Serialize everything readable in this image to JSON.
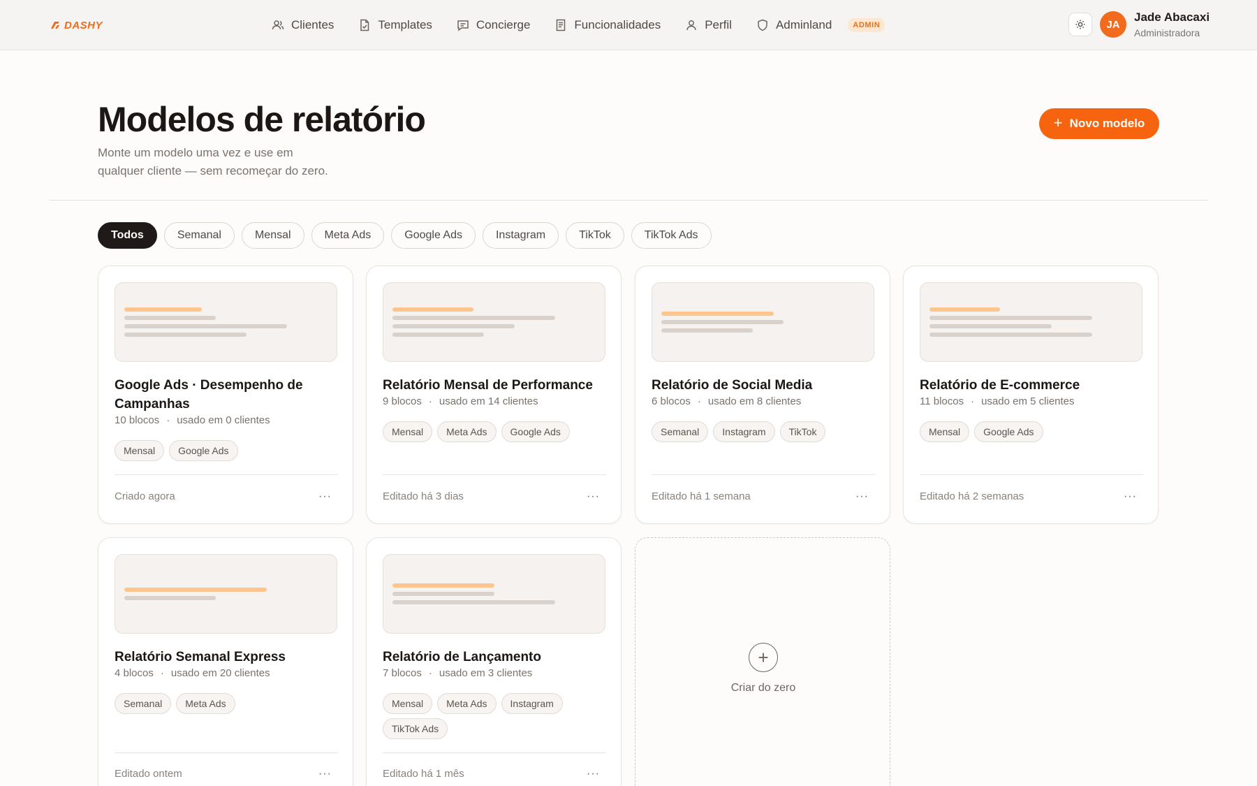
{
  "brand": {
    "name": "DASHY",
    "accent": "#f7640f"
  },
  "nav": [
    {
      "label": "Clientes",
      "icon": "users-icon"
    },
    {
      "label": "Templates",
      "icon": "file-check-icon"
    },
    {
      "label": "Concierge",
      "icon": "chat-icon"
    },
    {
      "label": "Funcionalidades",
      "icon": "document-icon"
    },
    {
      "label": "Perfil",
      "icon": "user-icon"
    },
    {
      "label": "Adminland",
      "icon": "shield-icon",
      "badge": "ADMIN"
    }
  ],
  "user": {
    "initials": "JA",
    "name": "Jade Abacaxi",
    "role": "Administradora"
  },
  "header": {
    "title": "Modelos de relatório",
    "subtitle": "Monte um modelo uma vez e use em qualquer cliente — sem recomeçar do zero.",
    "new_button": "Novo modelo"
  },
  "filters": [
    {
      "label": "Todos",
      "active": true
    },
    {
      "label": "Semanal"
    },
    {
      "label": "Mensal"
    },
    {
      "label": "Meta Ads"
    },
    {
      "label": "Google Ads"
    },
    {
      "label": "Instagram"
    },
    {
      "label": "TikTok"
    },
    {
      "label": "TikTok Ads"
    }
  ],
  "cards": [
    {
      "title": "Google Ads · Desempenho de Campanhas",
      "blocks": "10 blocos",
      "usage": "usado em 0 clientes",
      "tags": [
        "Mensal",
        "Google Ads"
      ],
      "footer": "Criado agora"
    },
    {
      "title": "Relatório Mensal de Performance",
      "blocks": "9 blocos",
      "usage": "usado em 14 clientes",
      "tags": [
        "Mensal",
        "Meta Ads",
        "Google Ads"
      ],
      "footer": "Editado há 3 dias"
    },
    {
      "title": "Relatório de Social Media",
      "blocks": "6 blocos",
      "usage": "usado em 8 clientes",
      "tags": [
        "Semanal",
        "Instagram",
        "TikTok"
      ],
      "footer": "Editado há 1 semana"
    },
    {
      "title": "Relatório de E-commerce",
      "blocks": "11 blocos",
      "usage": "usado em 5 clientes",
      "tags": [
        "Mensal",
        "Google Ads"
      ],
      "footer": "Editado há 2 semanas"
    },
    {
      "title": "Relatório Semanal Express",
      "blocks": "4 blocos",
      "usage": "usado em 20 clientes",
      "tags": [
        "Semanal",
        "Meta Ads"
      ],
      "footer": "Editado ontem"
    },
    {
      "title": "Relatório de Lançamento",
      "blocks": "7 blocos",
      "usage": "usado em 3 clientes",
      "tags": [
        "Mensal",
        "Meta Ads",
        "Instagram",
        "TikTok Ads"
      ],
      "footer": "Editado há 1 mês"
    }
  ],
  "create_card": {
    "label": "Criar do zero"
  }
}
